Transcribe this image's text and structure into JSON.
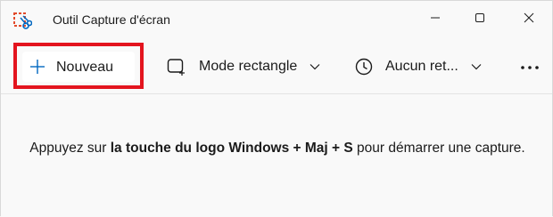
{
  "window": {
    "title": "Outil Capture d'écran"
  },
  "toolbar": {
    "new_label": "Nouveau",
    "mode_label": "Mode rectangle",
    "delay_label": "Aucun ret..."
  },
  "content": {
    "hint_prefix": "Appuyez sur ",
    "hint_bold": "la touche du logo Windows + Maj + S",
    "hint_suffix": " pour démarrer une capture."
  },
  "colors": {
    "highlight": "#e3141e",
    "accent_blue": "#0067c0"
  },
  "icons": {
    "app": "snipping-tool-icon",
    "minimize": "minimize-icon",
    "maximize": "maximize-icon",
    "close": "close-icon",
    "plus": "plus-icon",
    "mode": "rectangle-mode-icon",
    "delay": "clock-icon",
    "chevron": "chevron-down-icon",
    "more": "more-icon"
  }
}
